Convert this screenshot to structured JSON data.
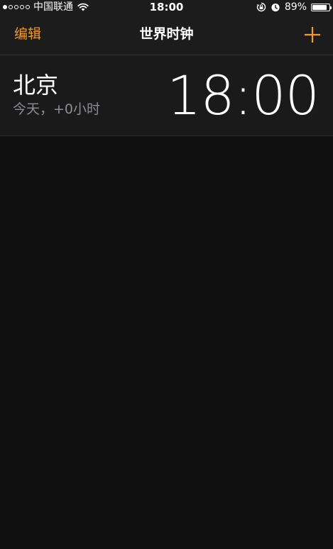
{
  "status_bar": {
    "carrier": "中国联通",
    "time": "18:00",
    "battery_percent": "89%",
    "battery_level": 0.89,
    "signal_bars_filled": 1,
    "signal_bars_total": 5,
    "icons": [
      "wifi-icon",
      "rotation-lock-icon",
      "alarm-icon",
      "battery-icon"
    ]
  },
  "nav": {
    "edit_label": "编辑",
    "title": "世界时钟",
    "add_icon": "plus-icon"
  },
  "colors": {
    "accent": "#f39a2c",
    "background": "#0f0f0f",
    "bar_background": "#1c1c1c",
    "secondary_text": "#8e8e93"
  },
  "clocks": [
    {
      "city": "北京",
      "offset": "今天，+0小时",
      "time": "18:00"
    }
  ]
}
